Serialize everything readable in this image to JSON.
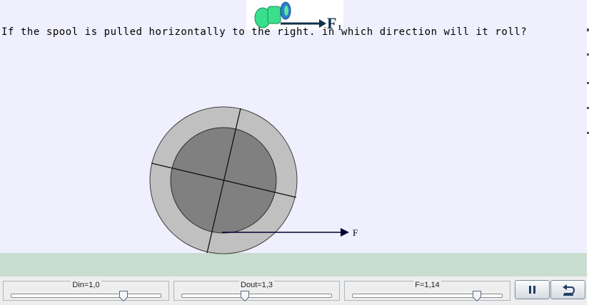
{
  "question": "If the spool is pulled horizontally to the right. in which direction will it roll?",
  "thumbnail": {
    "force_label": "F",
    "force_subscript": "1"
  },
  "force_label": "F",
  "sliders": [
    {
      "label": "Din=1,0",
      "fraction": 0.75
    },
    {
      "label": "Dout=1,3",
      "fraction": 0.42
    },
    {
      "label": "F=1,14",
      "fraction": 0.83
    }
  ],
  "buttons": {
    "pause_icon": "pause-icon",
    "reset_icon": "reset-icon"
  },
  "colors": {
    "background": "#efeffd",
    "ground": "#c8dccf",
    "outer_disk": "#c0c0c0",
    "inner_disk": "#808080",
    "thumb_spool": "#3adf8c",
    "thumb_flange": "#2c7fd0",
    "arrow": "#000033"
  }
}
